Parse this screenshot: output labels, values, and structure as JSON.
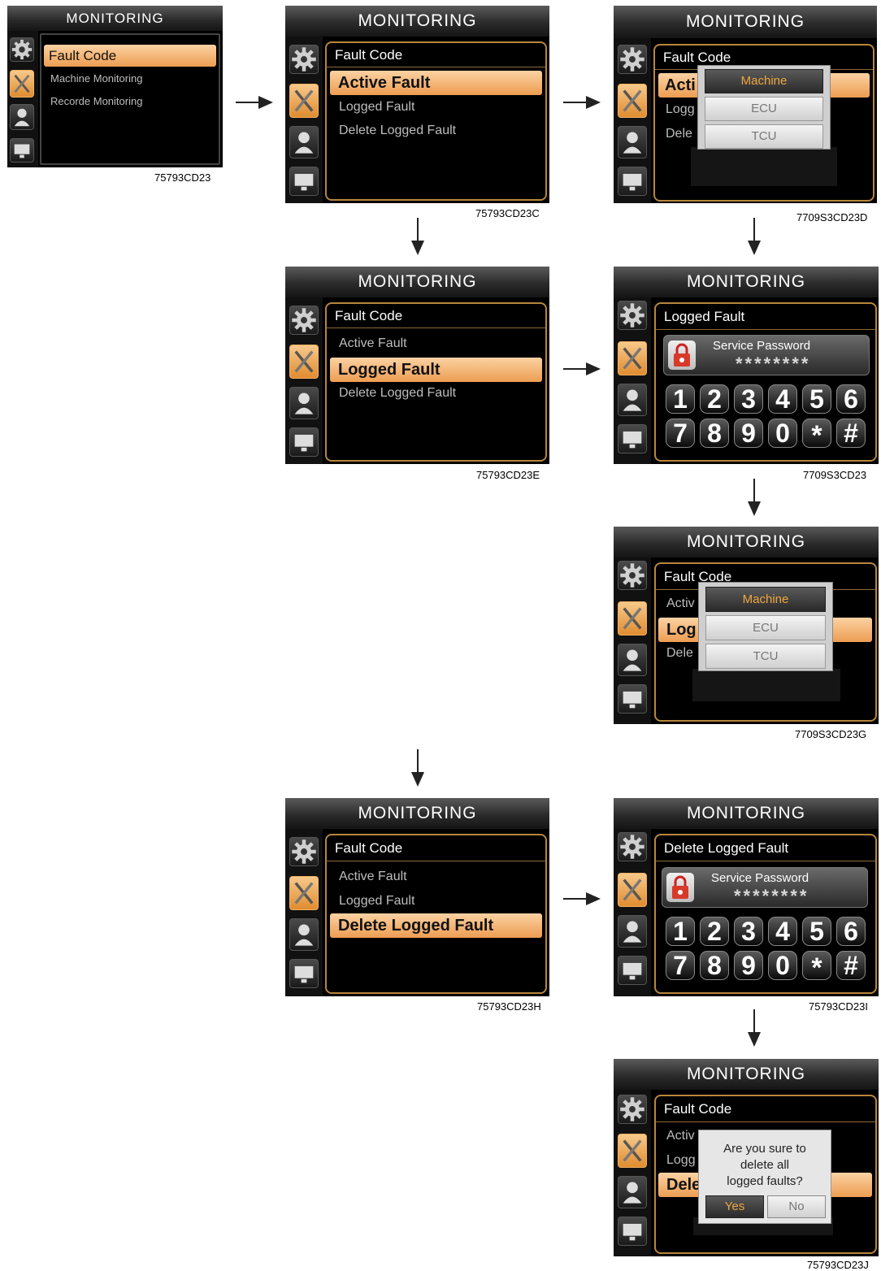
{
  "title": "MONITORING",
  "screens": {
    "s1": {
      "items": [
        "Fault Code",
        "Machine Monitoring",
        "Recorde Monitoring"
      ],
      "caption": "75793CD23"
    },
    "s2": {
      "header": "Fault Code",
      "items": [
        "Active Fault",
        "Logged Fault",
        "Delete Logged Fault"
      ],
      "caption": "75793CD23C"
    },
    "s3": {
      "header": "Fault Code",
      "items_partial": [
        "Acti",
        "Logg",
        "Dele"
      ],
      "popup": [
        "Machine",
        "ECU",
        "TCU"
      ],
      "caption": "7709S3CD23D"
    },
    "s4": {
      "header": "Fault Code",
      "items": [
        "Active Fault",
        "Logged Fault",
        "Delete Logged Fault"
      ],
      "caption": "75793CD23E"
    },
    "s5": {
      "header": "Logged Fault",
      "pw_label": "Service Password",
      "pw_stars": "********",
      "keys": [
        "1",
        "2",
        "3",
        "4",
        "5",
        "6",
        "7",
        "8",
        "9",
        "0",
        "*",
        "#"
      ],
      "caption": "7709S3CD23"
    },
    "s6": {
      "header": "Fault Code",
      "items_partial": [
        "Activ",
        "Log",
        "Dele"
      ],
      "popup": [
        "Machine",
        "ECU",
        "TCU"
      ],
      "caption": "7709S3CD23G"
    },
    "s7": {
      "header": "Fault Code",
      "items": [
        "Active Fault",
        "Logged Fault",
        "Delete Logged Fault"
      ],
      "caption": "75793CD23H"
    },
    "s8": {
      "header": "Delete Logged Fault",
      "pw_label": "Service Password",
      "pw_stars": "********",
      "keys": [
        "1",
        "2",
        "3",
        "4",
        "5",
        "6",
        "7",
        "8",
        "9",
        "0",
        "*",
        "#"
      ],
      "caption": "75793CD23I"
    },
    "s9": {
      "header": "Fault Code",
      "items_partial": [
        "Activ",
        "Logg",
        "Dele"
      ],
      "confirm_lines": [
        "Are you sure to",
        "delete all",
        "logged faults?"
      ],
      "yes": "Yes",
      "no": "No",
      "caption": "75793CD23J"
    }
  },
  "colors": {
    "accent_orange": "#ed9d52",
    "panel_border": "#b8863b",
    "popup_selected_text": "#f0a640"
  },
  "icons": [
    "settings-gear-icon",
    "tools-wrench-icon",
    "user-icon",
    "monitor-display-icon",
    "padlock-icon"
  ]
}
